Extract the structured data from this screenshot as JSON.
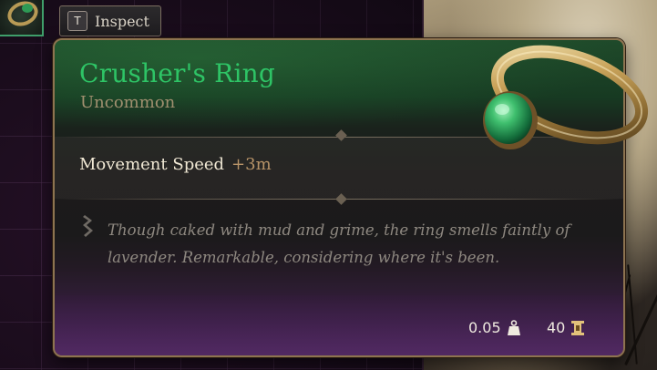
{
  "prompt": {
    "key": "T",
    "label": "Inspect"
  },
  "item": {
    "name": "Crusher's Ring",
    "rarity": "Uncommon",
    "stat": {
      "label": "Movement Speed",
      "value": "+3m"
    },
    "description": "Though caked with mud and grime, the ring smells faintly of lavender. Remarkable, considering where it's been.",
    "weight": "0.05",
    "price": "40"
  },
  "icons": {
    "weight": "weight-icon",
    "price": "coin-icon",
    "description": "quill-icon",
    "item": "ring-icon"
  },
  "colors": {
    "rarity_name": "#2ec466",
    "border": "#8d7350",
    "stat_value": "#b89468"
  }
}
